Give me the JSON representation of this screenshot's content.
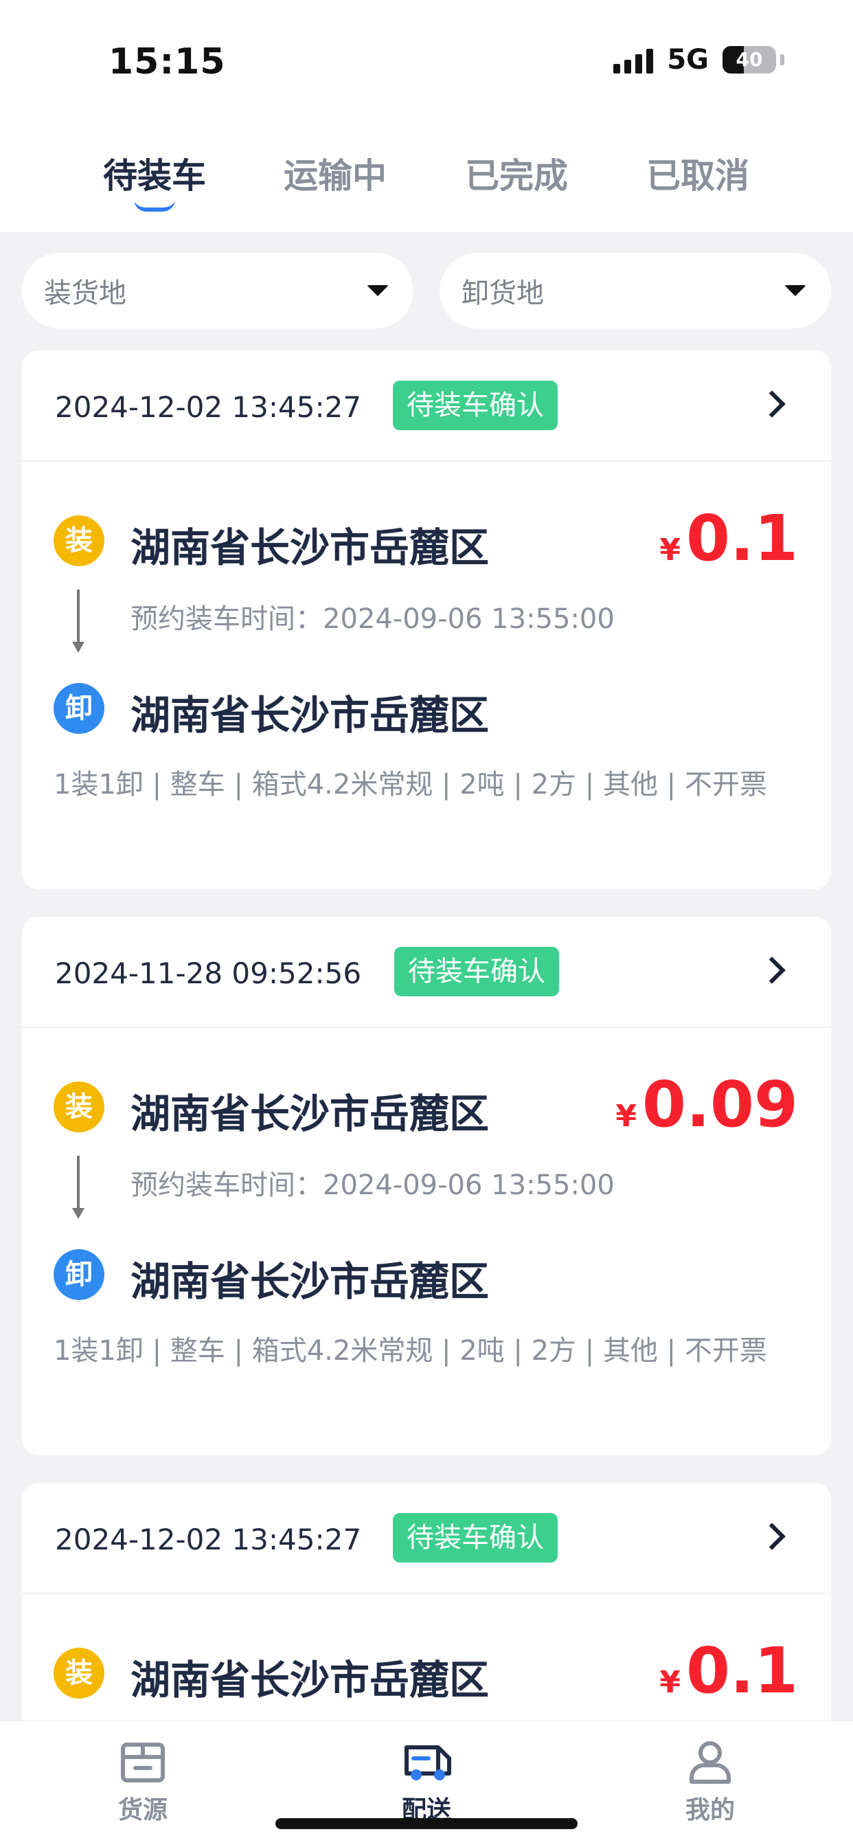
{
  "status_bar": {
    "time": "15:15",
    "network": "5G",
    "battery": "40"
  },
  "tabs": [
    {
      "label": "待装车",
      "active": true
    },
    {
      "label": "运输中",
      "active": false
    },
    {
      "label": "已完成",
      "active": false
    },
    {
      "label": "已取消",
      "active": false
    }
  ],
  "filters": {
    "load_place": "装货地",
    "unload_place": "卸货地"
  },
  "orders": [
    {
      "time": "2024-12-02 13:45:27",
      "status": "待装车确认",
      "load_icon": "装",
      "load_address": "湖南省长沙市岳麓区",
      "price_symbol": "¥",
      "price": "0.1",
      "appointment": "预约装车时间：2024-09-06 13:55:00",
      "unload_icon": "卸",
      "unload_address": "湖南省长沙市岳麓区",
      "specs": "1装1卸 | 整车 | 箱式4.2米常规 | 2吨 | 2方 | 其他 | 不开票"
    },
    {
      "time": "2024-11-28 09:52:56",
      "status": "待装车确认",
      "load_icon": "装",
      "load_address": "湖南省长沙市岳麓区",
      "price_symbol": "¥",
      "price": "0.09",
      "appointment": "预约装车时间：2024-09-06 13:55:00",
      "unload_icon": "卸",
      "unload_address": "湖南省长沙市岳麓区",
      "specs": "1装1卸 | 整车 | 箱式4.2米常规 | 2吨 | 2方 | 其他 | 不开票"
    },
    {
      "time": "2024-12-02 13:45:27",
      "status": "待装车确认",
      "load_icon": "装",
      "load_address": "湖南省长沙市岳麓区",
      "price_symbol": "¥",
      "price": "0.1"
    }
  ],
  "bottom_nav": [
    {
      "label": "货源",
      "icon": "cargo-box-icon",
      "active": false
    },
    {
      "label": "配送",
      "icon": "delivery-truck-icon",
      "active": true
    },
    {
      "label": "我的",
      "icon": "user-icon",
      "active": false
    }
  ],
  "colors": {
    "accent": "#2f7bf0",
    "badge": "#3ccf8e",
    "price": "#f5222d",
    "load_icon": "#f5b800",
    "unload_icon": "#2f8bf0"
  }
}
